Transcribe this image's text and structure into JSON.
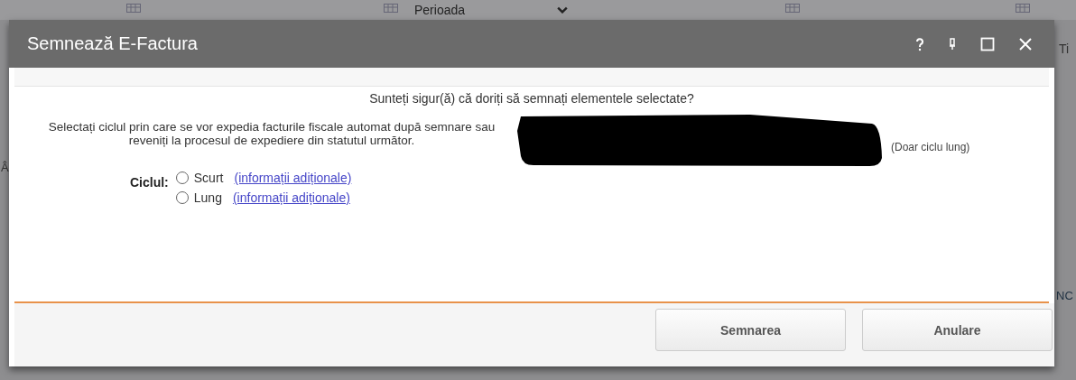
{
  "background": {
    "period_select": "Perioada",
    "edge_texts": [
      "Ti",
      "NC",
      "Â"
    ]
  },
  "dialog": {
    "title": "Semnează E-Factura",
    "question": "Sunteți sigur(ă) că doriți să semnați elementele selectate?",
    "instruction": "Selectați ciclul prin care se vor expedia facturile fiscale automat după semnare sau reveniți la procesul de expediere din statutul următor.",
    "note": "(Doar ciclu lung)",
    "cycle_label": "Ciclul:",
    "options": [
      {
        "label": "Scurt",
        "link": "(informații adiționale)",
        "selected": false
      },
      {
        "label": "Lung",
        "link": "(informații adiționale)",
        "selected": false
      }
    ],
    "buttons": [
      "Semnarea",
      "Anulare"
    ]
  }
}
